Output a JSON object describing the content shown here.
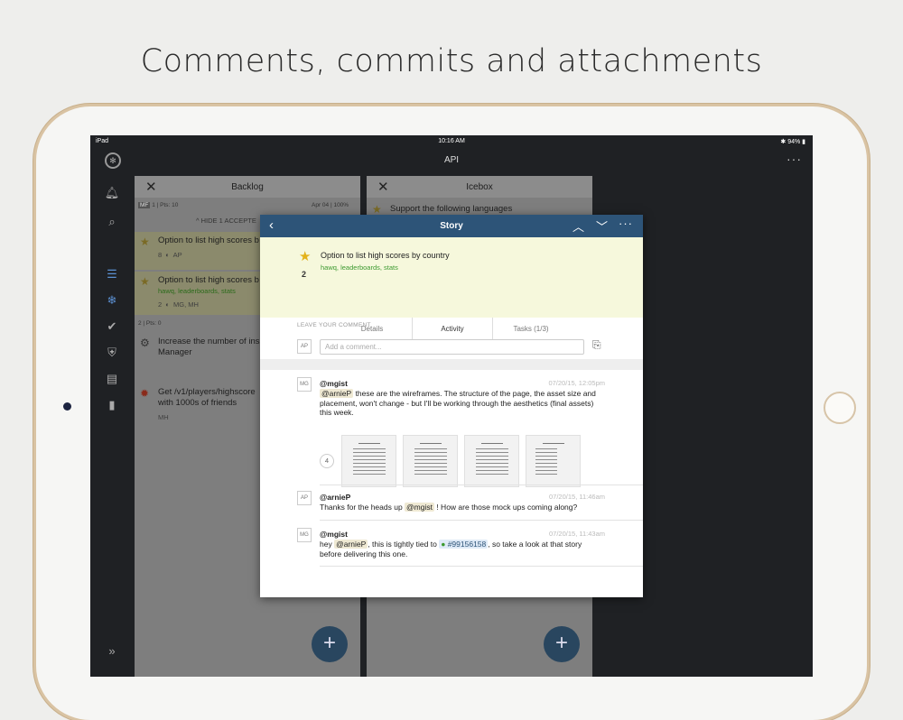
{
  "headline": "Comments, commits and attachments",
  "status_bar": {
    "device": "iPad",
    "time": "10:16 AM",
    "battery": "94%"
  },
  "app": {
    "title": "API"
  },
  "sidebar": {
    "icons": [
      "logo-icon",
      "bell-icon",
      "search-icon",
      "list-icon",
      "snowflake-icon",
      "check-icon",
      "shield-icon",
      "inbox-icon",
      "chart-icon",
      "expand-icon"
    ]
  },
  "backlog": {
    "title": "Backlog",
    "meta_left": "1 | Pts: 10",
    "meta_right": "Apr 04 | 100%",
    "hide_accepted": "^ HIDE 1 ACCEPTE",
    "cards": [
      {
        "title": "Option to list high scores b",
        "estimate": "8",
        "owners": "AP"
      },
      {
        "title": "Option to list high scores b",
        "labels": "hawq, leaderboards, stats",
        "estimate": "2",
        "owners": "MG, MH"
      }
    ],
    "group_meta": "2 | Pts: 0",
    "chores": [
      {
        "title": "Increase the number of ins",
        "title2": "Manager"
      },
      {
        "title": "Get /v1/players/highscore",
        "title2": "with 1000s of friends",
        "owners": "MH"
      }
    ]
  },
  "icebox": {
    "title": "Icebox",
    "first_item": "Support the following languages"
  },
  "story": {
    "header_title": "Story",
    "name": "Option to list high scores by country",
    "labels": "hawq, leaderboards, stats",
    "estimate": "2",
    "tabs": [
      "Details",
      "Activity",
      "Tasks (1/3)"
    ],
    "leave_comment_label": "LEAVE YOUR COMMENT",
    "current_user_initials": "AP",
    "comment_placeholder": "Add a comment...",
    "comments": [
      {
        "initials": "MG",
        "author": "@mgist",
        "timestamp": "07/20/15, 12:05pm",
        "mention": "@arnieP",
        "text": " these are the wireframes. The structure of the page, the asset size and placement, won't change - but I'll be working through the aesthetics (final assets) this week.",
        "attachment_count": "4"
      },
      {
        "initials": "AP",
        "author": "@arnieP",
        "timestamp": "07/20/15, 11:46am",
        "text_before": "Thanks for the heads up ",
        "mention": "@mgist",
        "text_after": " ! How are those mock ups coming along?"
      },
      {
        "initials": "MG",
        "author": "@mgist",
        "timestamp": "07/20/15, 11:43am",
        "text_before": "hey ",
        "mention": "@arnieP",
        "text_middle": ", this is tightly tied to ",
        "story_ref": "#99156158",
        "text_after": ", so take a look at that story before delivering this one."
      }
    ]
  },
  "colors": {
    "modal_header": "#2d5478",
    "summary_bg": "#f6f8dc",
    "label_green": "#3d9a30",
    "star": "#e3b21a"
  }
}
